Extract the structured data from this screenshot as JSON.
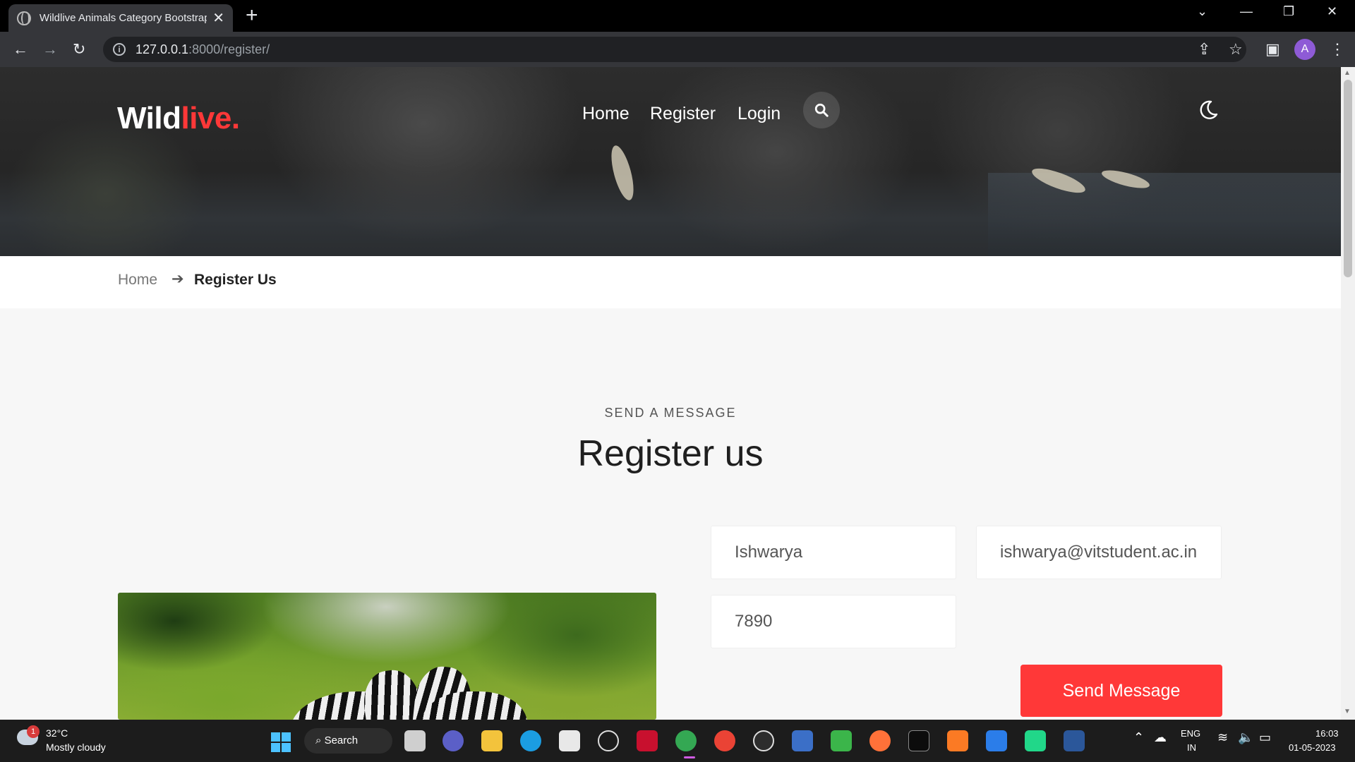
{
  "browser": {
    "tab_title": "Wildlive Animals Category Bootstrap",
    "url_host": "127.0.0.1",
    "url_path": ":8000/register/",
    "profile_initial": "A",
    "icons": [
      "globe-icon",
      "close-icon",
      "new-tab-icon",
      "back-icon",
      "forward-icon",
      "reload-icon",
      "site-info-icon",
      "share-icon",
      "bookmark-star-icon",
      "side-panel-icon",
      "menu-kebab-icon"
    ]
  },
  "site": {
    "logo_main": "Wild",
    "logo_accent": "live.",
    "nav": [
      {
        "label": "Home"
      },
      {
        "label": "Register"
      },
      {
        "label": "Login"
      }
    ],
    "accent_color": "#ff3838"
  },
  "breadcrumb": {
    "home": "Home",
    "current": "Register Us"
  },
  "section": {
    "eyebrow": "SEND A MESSAGE",
    "heading": "Register us"
  },
  "form": {
    "name_value": "Ishwarya",
    "email_value": "ishwarya@vitstudent.ac.in",
    "phone_value": "7890",
    "submit_label": "Send Message"
  },
  "taskbar": {
    "weather_alert_count": "1",
    "weather_temp": "32°C",
    "weather_desc": "Mostly cloudy",
    "search_label": "Search",
    "lang_line1": "ENG",
    "lang_line2": "IN",
    "time": "16:03",
    "date": "01-05-2023"
  }
}
